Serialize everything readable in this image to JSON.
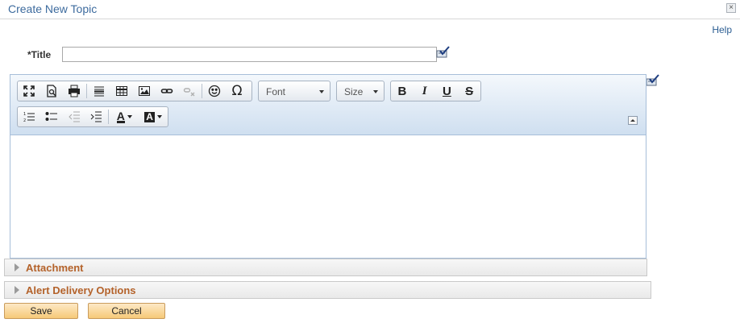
{
  "header": {
    "title": "Create New Topic",
    "close_glyph": "×",
    "help_label": "Help"
  },
  "title_field": {
    "label": "*Title",
    "value": ""
  },
  "editor": {
    "font_label": "Font",
    "size_label": "Size",
    "format_labels": {
      "bold": "B",
      "italic": "I",
      "underline": "U",
      "strike": "S"
    },
    "text_color_label": "A",
    "bg_color_label": "A",
    "special_char": "Ω"
  },
  "sections": {
    "attachment": "Attachment",
    "alert_delivery": "Alert Delivery Options"
  },
  "buttons": {
    "save": "Save",
    "cancel": "Cancel"
  }
}
